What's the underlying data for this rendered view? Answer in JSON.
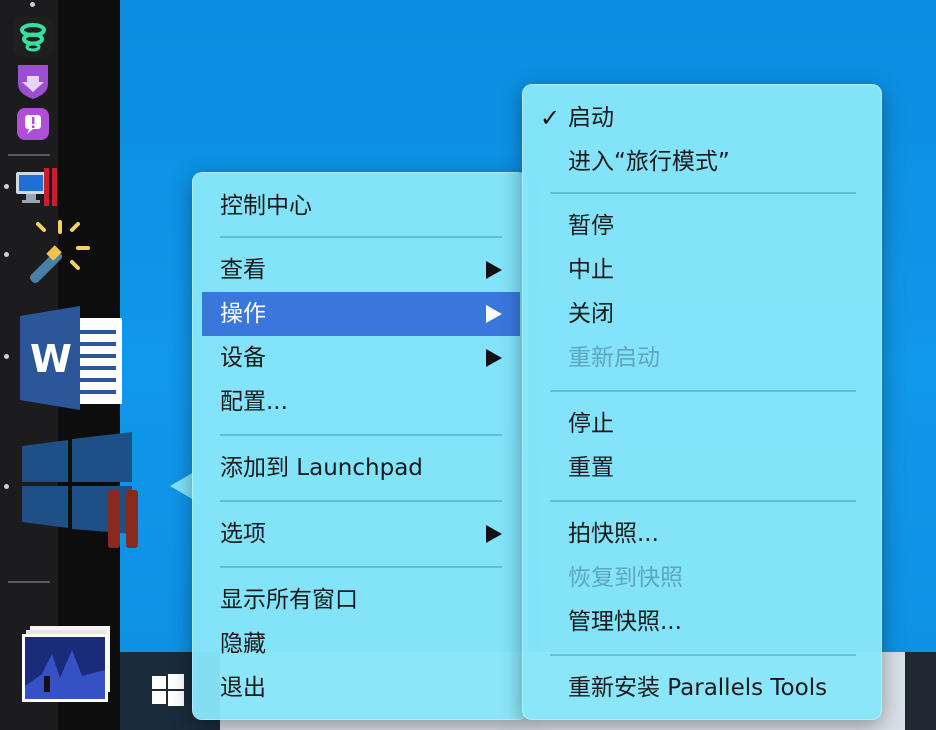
{
  "main_menu": {
    "items": [
      {
        "label": "控制中心"
      },
      {
        "label": "查看"
      },
      {
        "label": "操作"
      },
      {
        "label": "设备"
      },
      {
        "label": "配置..."
      },
      {
        "label": "添加到 Launchpad"
      },
      {
        "label": "选项"
      },
      {
        "label": "显示所有窗口"
      },
      {
        "label": "隐藏"
      },
      {
        "label": "退出"
      }
    ]
  },
  "sub_menu": {
    "check_glyph": "✓",
    "items": [
      {
        "label": "启动"
      },
      {
        "label": "进入“旅行模式”"
      },
      {
        "label": "暂停"
      },
      {
        "label": "中止"
      },
      {
        "label": "关闭"
      },
      {
        "label": "重新启动"
      },
      {
        "label": "停止"
      },
      {
        "label": "重置"
      },
      {
        "label": "拍快照..."
      },
      {
        "label": "恢复到快照"
      },
      {
        "label": "管理快照..."
      },
      {
        "label": "重新安装 Parallels Tools"
      }
    ]
  },
  "colors": {
    "desktop_blue": "#0b8ce0",
    "menu_bg": "#87e6fa",
    "highlight": "#3a77dd",
    "disabled_text": "#5fa7bd"
  },
  "icons": {
    "dock": [
      "green-swirl-app-icon",
      "purple-shield-download-icon",
      "purple-chat-alert-icon",
      "monitor-parallels-icon",
      "magic-wand-icon",
      "word-document-icon",
      "windows-parallels-icon",
      "presentation-thumbnail-icon"
    ],
    "taskbar": [
      "windows-start-icon"
    ]
  }
}
